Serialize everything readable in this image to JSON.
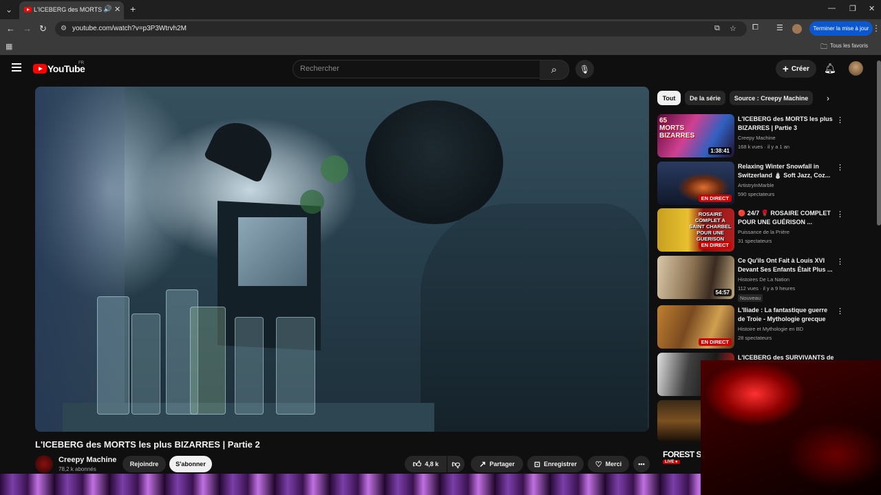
{
  "browser": {
    "tab_title": "L'ICEBERG des MORTS les plus BIZARRES | Partie 2",
    "url": "youtube.com/watch?v=p3P3Wtrvh2M",
    "update_button": "Terminer la mise à jour",
    "bookmarks_all": "Tous les favoris"
  },
  "header": {
    "logo_text": "YouTube",
    "country": "FR",
    "search_placeholder": "Rechercher",
    "create_label": "Créer"
  },
  "video": {
    "title": "L'ICEBERG des MORTS les plus BIZARRES | Partie 2",
    "channel": "Creepy Machine",
    "subscribers": "78,2 k abonnés",
    "join": "Rejoindre",
    "subscribe": "S'abonner",
    "likes": "4,8 k",
    "share": "Partager",
    "save": "Enregistrer",
    "thanks": "Merci"
  },
  "chips": [
    "Tout",
    "De la série",
    "Source : Creepy Machine"
  ],
  "recommendations": [
    {
      "title": "L'ICEBERG des MORTS les plus BIZARRES | Partie 3",
      "channel": "Creepy Machine",
      "meta": "168 k vues · il y a 1 an",
      "badge": "1:38:41",
      "live": false
    },
    {
      "title": "Relaxing Winter Snowfall in Switzerland ⛄ Soft Jazz, Coz...",
      "channel": "ArtistryInMarble",
      "meta": "590 spectateurs",
      "badge": "EN DIRECT",
      "live": true
    },
    {
      "title": "🔴 24/7 🌹 ROSAIRE COMPLET POUR UNE GUÉRISON ...",
      "channel": "Puissance de la Prière",
      "meta": "31 spectateurs",
      "badge": "EN DIRECT",
      "live": true
    },
    {
      "title": "Ce Qu'ils Ont Fait à Louis XVI Devant Ses Enfants Était Plus ...",
      "channel": "Histoires De La Nation",
      "meta": "112 vues · il y a 9 heures",
      "badge": "54:57",
      "live": false,
      "new": "Nouveau"
    },
    {
      "title": "L'Iliade : La fantastique guerre de Troie - Mythologie grecque",
      "channel": "Histoire et Mythologie en BD",
      "meta": "28 spectateurs",
      "badge": "EN DIRECT",
      "live": true
    },
    {
      "title": "L'ICEBERG des SURVIVANTS de",
      "channel": "",
      "meta": "",
      "badge": "",
      "live": false
    }
  ],
  "thumb_texts": {
    "r0": "65 MORTS BIZARRES",
    "r2": "ROSAIRE COMPLET A SAINT CHARBEL POUR UNE GUERISON"
  },
  "overlay": {
    "forest_title": "FOREST S",
    "forest_live": "LIVE ●"
  },
  "colors": {
    "accent_red": "#ff0000",
    "live_red": "#cc0000",
    "update_blue": "#0b57d0",
    "background": "#0f0f0f"
  }
}
